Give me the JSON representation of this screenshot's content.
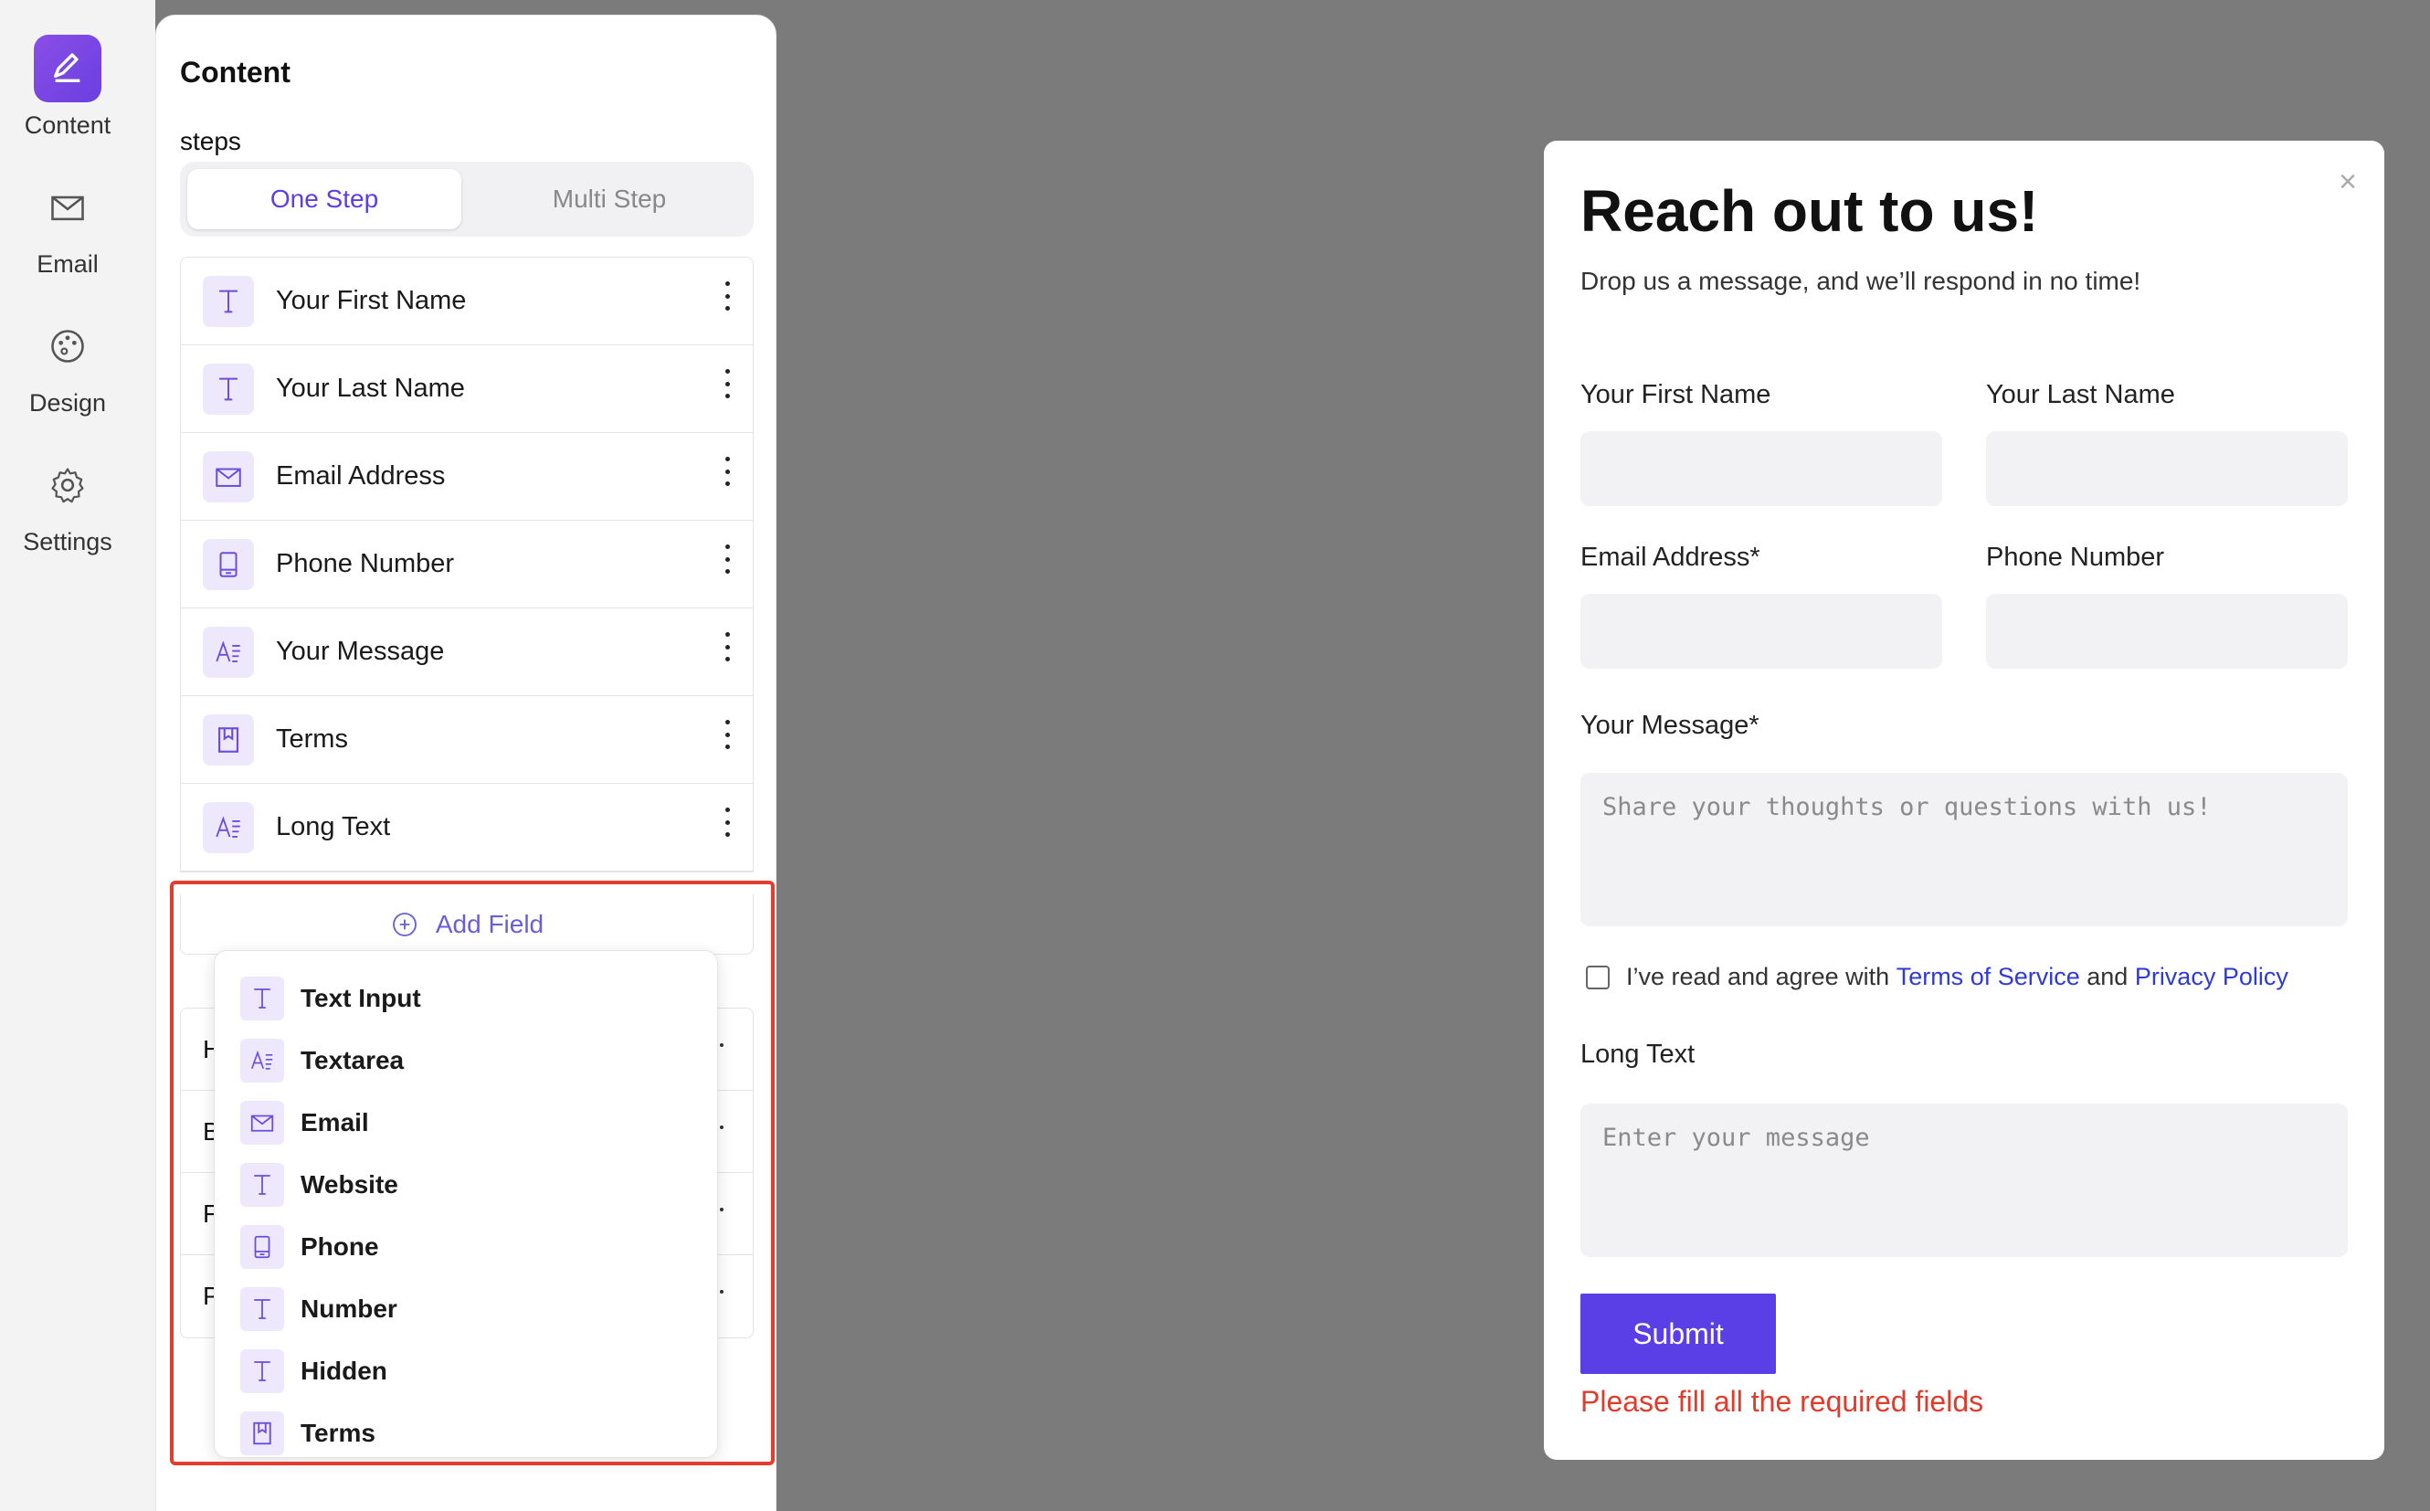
{
  "rail": {
    "items": [
      {
        "label": "Content",
        "icon": "pencil-icon",
        "active": true
      },
      {
        "label": "Email",
        "icon": "mail-icon"
      },
      {
        "label": "Design",
        "icon": "palette-icon"
      },
      {
        "label": "Settings",
        "icon": "gear-icon"
      }
    ]
  },
  "panel": {
    "title": "Content",
    "steps_label": "steps",
    "tabs": {
      "one_step": "One Step",
      "multi_step": "Multi Step"
    },
    "fields": [
      {
        "label": "Your First Name",
        "icon": "text-icon"
      },
      {
        "label": "Your Last Name",
        "icon": "text-icon"
      },
      {
        "label": "Email Address",
        "icon": "mail-icon"
      },
      {
        "label": "Phone Number",
        "icon": "phone-icon"
      },
      {
        "label": "Your Message",
        "icon": "textarea-icon"
      },
      {
        "label": "Terms",
        "icon": "bookmark-icon"
      },
      {
        "label": "Long Text",
        "icon": "textarea-icon"
      }
    ],
    "add_field": "Add Field",
    "hidden_rows": [
      "H",
      "B",
      "F",
      "P"
    ]
  },
  "dropdown": {
    "items": [
      {
        "label": "Text Input",
        "icon": "text-icon"
      },
      {
        "label": "Textarea",
        "icon": "textarea-icon"
      },
      {
        "label": "Email",
        "icon": "mail-icon"
      },
      {
        "label": "Website",
        "icon": "text-icon"
      },
      {
        "label": "Phone",
        "icon": "phone-icon"
      },
      {
        "label": "Number",
        "icon": "text-icon"
      },
      {
        "label": "Hidden",
        "icon": "text-icon"
      },
      {
        "label": "Terms",
        "icon": "bookmark-icon"
      }
    ]
  },
  "form": {
    "title": "Reach out to us!",
    "subtitle": "Drop us a message, and we’ll respond in no time!",
    "close": "×",
    "first_name_label": "Your First Name",
    "last_name_label": "Your Last Name",
    "email_label": "Email Address*",
    "phone_label": "Phone Number",
    "message_label": "Your Message*",
    "message_placeholder": "Share your thoughts or questions with us!",
    "terms_prefix": "I’ve read and agree with ",
    "terms_link": "Terms of Service",
    "terms_and": " and ",
    "privacy_link": "Privacy Policy",
    "long_text_label": "Long Text",
    "long_text_placeholder": "Enter your message",
    "submit": "Submit",
    "error": "Please fill all the required fields"
  },
  "colors": {
    "accent": "#5a3ee6",
    "error": "#e13b2b",
    "backdrop": "#7b7b7b",
    "link": "#2f3bd8"
  }
}
